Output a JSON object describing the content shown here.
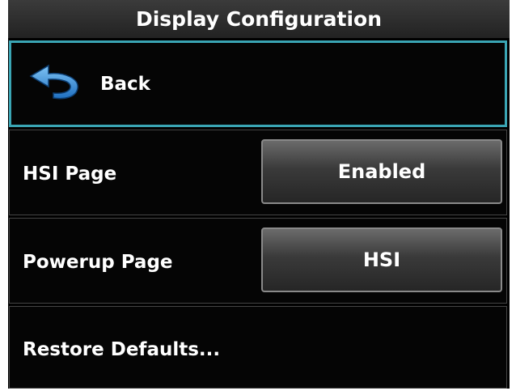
{
  "title": "Display Configuration",
  "back": {
    "label": "Back",
    "icon": "back-arrow-icon"
  },
  "hsi_page": {
    "label": "HSI Page",
    "value": "Enabled"
  },
  "powerup_page": {
    "label": "Powerup Page",
    "value": "HSI"
  },
  "restore_defaults": {
    "label": "Restore Defaults..."
  },
  "colors": {
    "selection_border": "#3aa5b4",
    "back_icon": "#3b8ed8",
    "background": "#000000"
  }
}
